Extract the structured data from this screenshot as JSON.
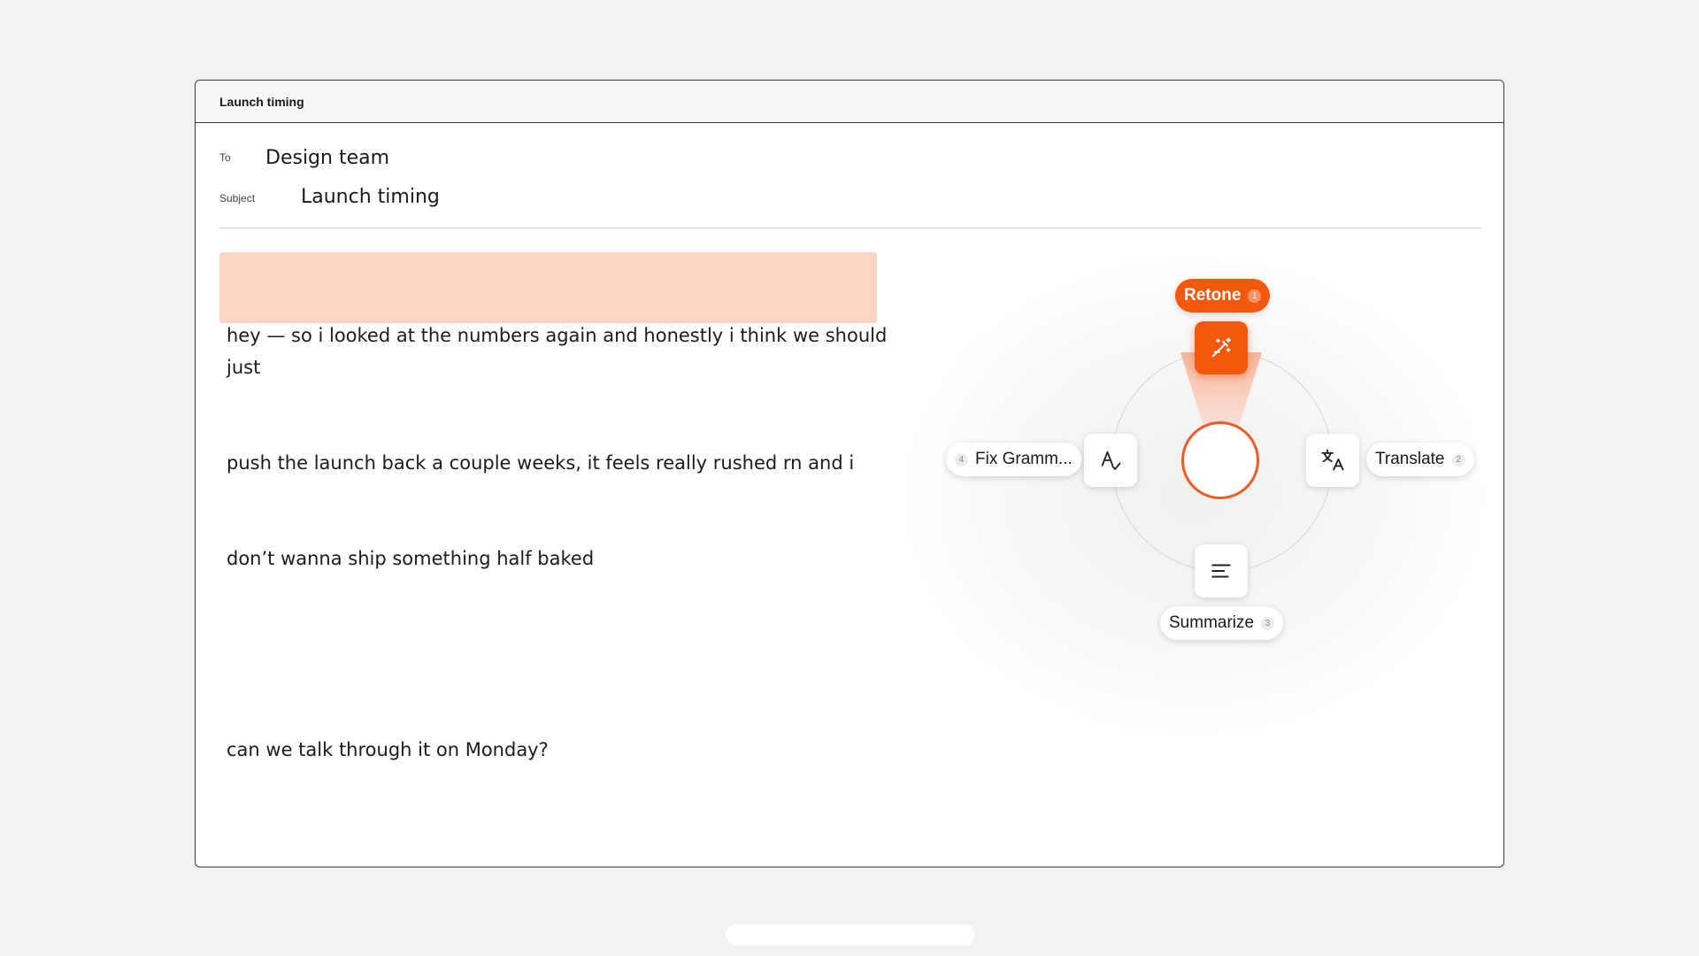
{
  "window": {
    "title": "Launch timing"
  },
  "compose": {
    "to_label": "To",
    "to_value": "Design team",
    "subject_label": "Subject",
    "subject_value": "Launch timing",
    "body_lines": [
      "hey — so i looked at the numbers again and honestly i think we should just",
      "push the launch back a couple weeks, it feels really rushed rn and i",
      "don’t wanna ship something half baked",
      "",
      "can we talk through it on Monday?"
    ]
  },
  "radial_menu": {
    "accent_color": "#f4580c",
    "selection_color": "#fdd5c5",
    "actions": [
      {
        "label": "Retone",
        "shortcut": "1",
        "icon": "magic-wand-icon",
        "active": true
      },
      {
        "label": "Translate",
        "shortcut": "2",
        "icon": "translate-icon",
        "active": false
      },
      {
        "label": "Summarize",
        "shortcut": "3",
        "icon": "summarize-lines-icon",
        "active": false
      },
      {
        "label": "Fix Gramm...",
        "shortcut": "4",
        "icon": "spellcheck-icon",
        "active": false
      }
    ]
  }
}
